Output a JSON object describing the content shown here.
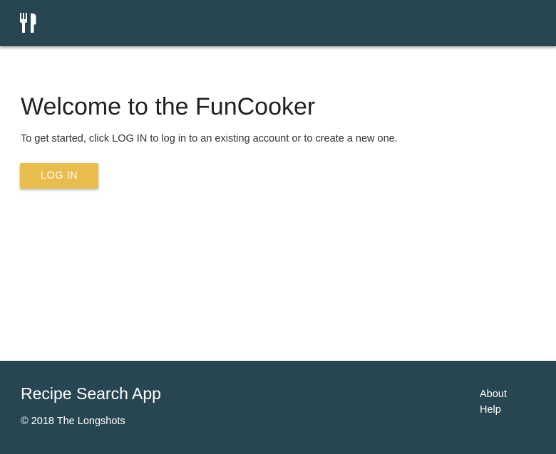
{
  "header": {
    "logo_icon": "fork-knife-icon",
    "background_color": "#274652"
  },
  "main": {
    "title": "Welcome to the FunCooker",
    "intro": "To get started, click LOG IN to log in to an existing account or to create a new one.",
    "login_label": "LOG IN",
    "login_color": "#e9bd4d"
  },
  "footer": {
    "app_name": "Recipe Search App",
    "copyright": "© 2018 The Longshots",
    "links": [
      {
        "label": "About"
      },
      {
        "label": "Help"
      }
    ]
  }
}
